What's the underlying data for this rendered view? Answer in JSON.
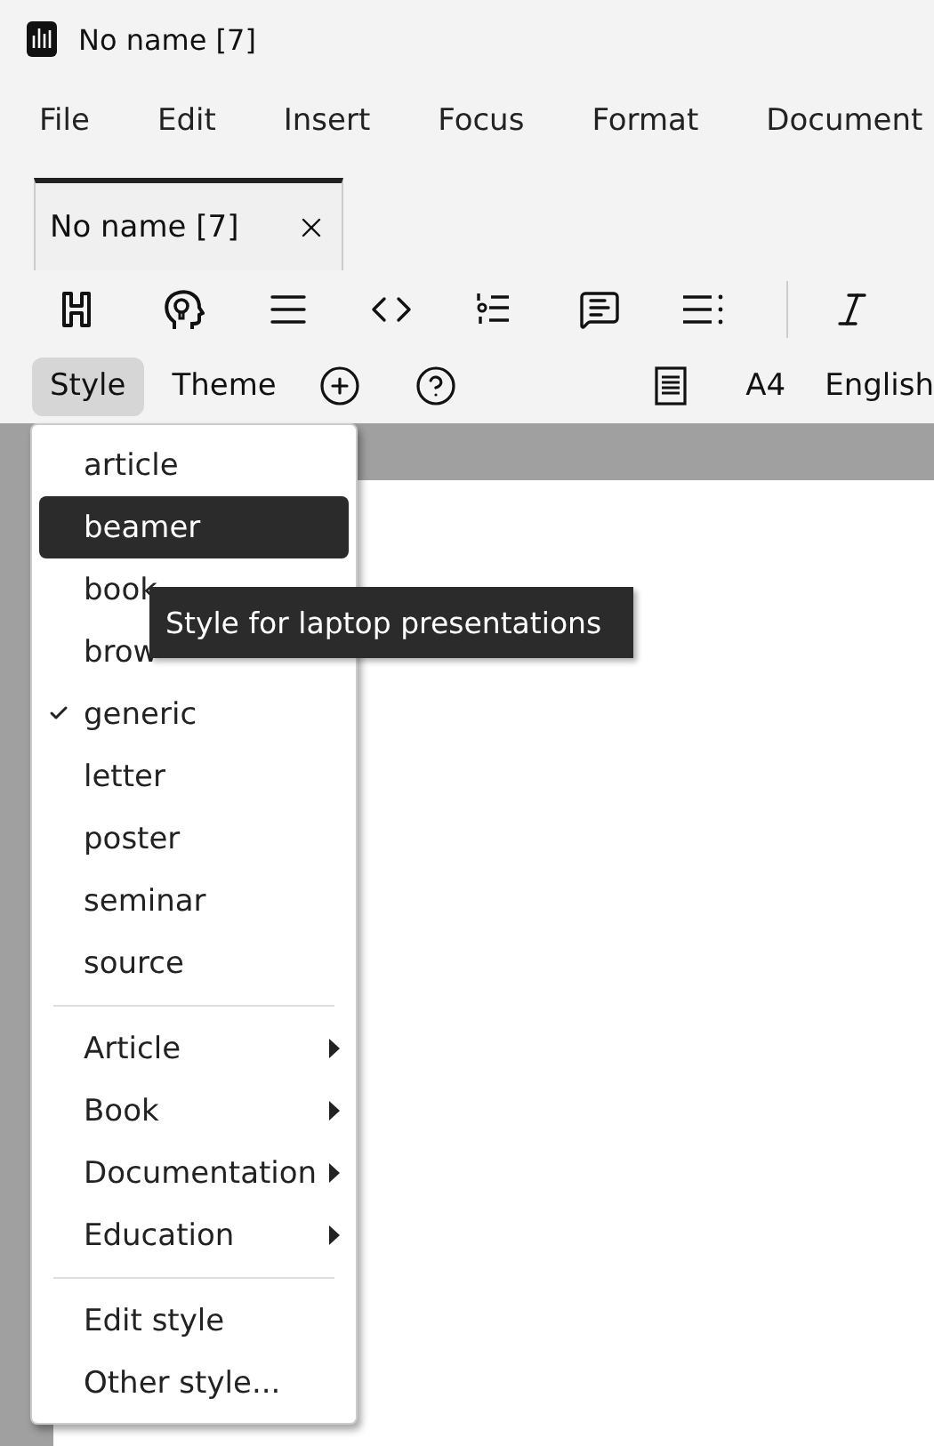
{
  "window": {
    "title": "No name [7]"
  },
  "menu_bar": [
    "File",
    "Edit",
    "Insert",
    "Focus",
    "Format",
    "Document"
  ],
  "tabs": [
    {
      "label": "No name [7]",
      "selected": true
    }
  ],
  "style_bar": {
    "buttons": [
      {
        "label": "Style",
        "selected": true
      },
      {
        "label": "Theme",
        "selected": false
      }
    ],
    "right": [
      "A4",
      "English"
    ]
  },
  "style_menu": {
    "groups": [
      [
        {
          "kind": "style",
          "label": "article",
          "selected": false,
          "checked": false
        },
        {
          "kind": "style",
          "label": "beamer",
          "selected": true,
          "checked": false
        },
        {
          "kind": "style",
          "label": "book",
          "selected": false,
          "checked": false
        },
        {
          "kind": "style",
          "label": "brow",
          "selected": false,
          "checked": false
        },
        {
          "kind": "style",
          "label": "generic",
          "selected": false,
          "checked": true
        },
        {
          "kind": "style",
          "label": "letter",
          "selected": false,
          "checked": false
        },
        {
          "kind": "style",
          "label": "poster",
          "selected": false,
          "checked": false
        },
        {
          "kind": "style",
          "label": "seminar",
          "selected": false,
          "checked": false
        },
        {
          "kind": "style",
          "label": "source",
          "selected": false,
          "checked": false
        }
      ],
      [
        {
          "kind": "submenu",
          "label": "Article",
          "selected": false
        },
        {
          "kind": "submenu",
          "label": "Book",
          "selected": false
        },
        {
          "kind": "submenu",
          "label": "Documentation",
          "selected": false
        },
        {
          "kind": "submenu",
          "label": "Education",
          "selected": false
        }
      ],
      [
        {
          "kind": "action",
          "label": "Edit style",
          "selected": false
        },
        {
          "kind": "action",
          "label": "Other style...",
          "selected": false
        }
      ]
    ]
  },
  "tooltip": "Style for laptop presentations"
}
